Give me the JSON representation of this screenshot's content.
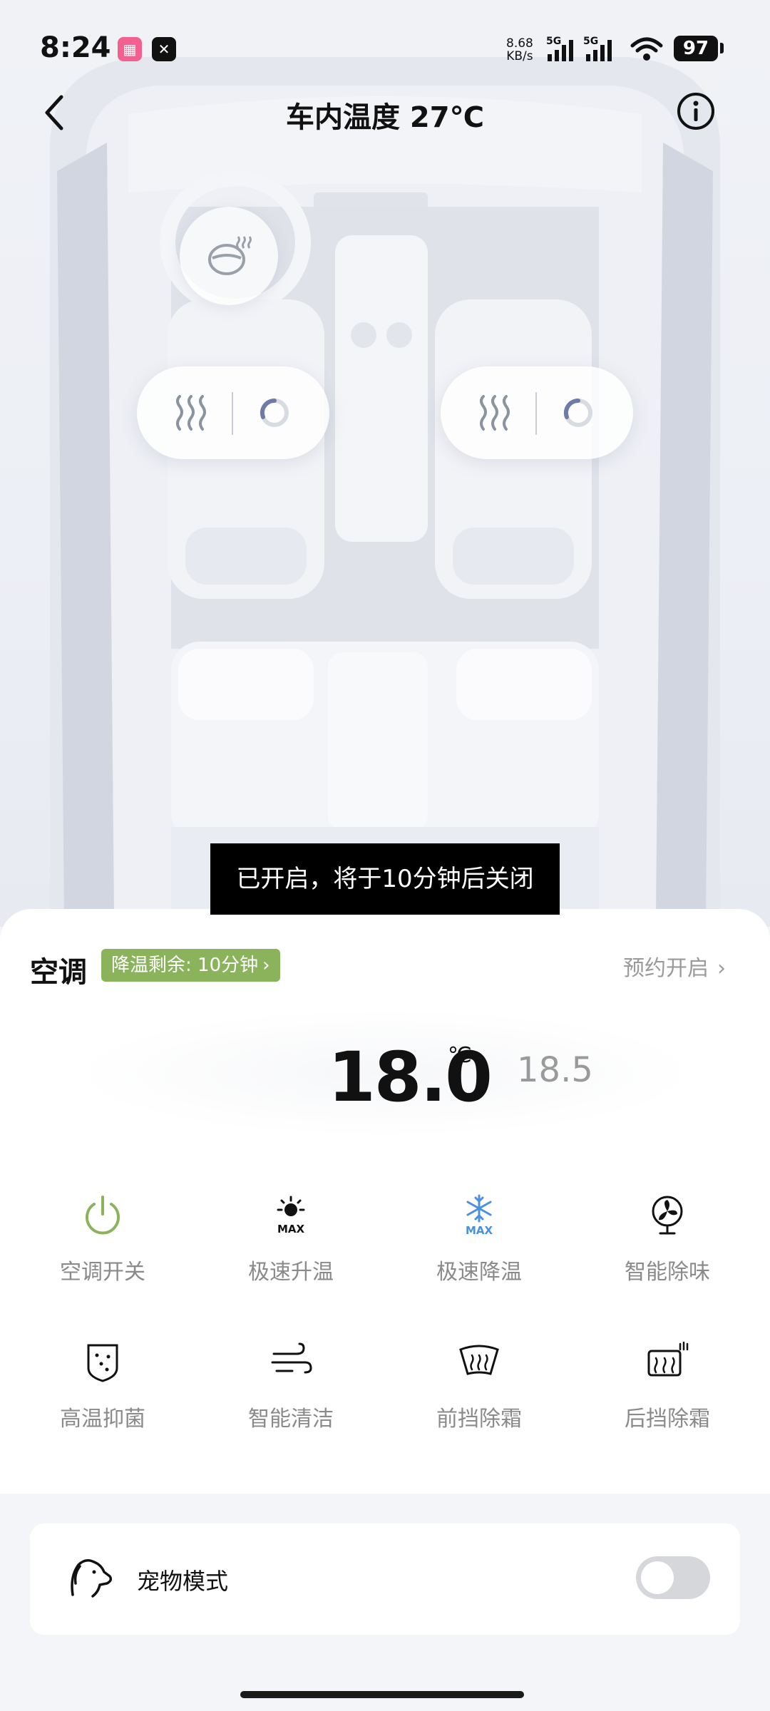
{
  "status_bar": {
    "time": "8:24",
    "net_speed_value": "8.68",
    "net_speed_unit": "KB/s",
    "signal_1_label": "5G",
    "signal_2_label": "5G",
    "battery": "97"
  },
  "header": {
    "title": "车内温度 27℃"
  },
  "toast": {
    "text": "已开启，将于10分钟后关闭"
  },
  "ac_panel": {
    "title": "空调",
    "cooling_badge": "降温剩余: 10分钟",
    "schedule_label": "预约开启",
    "temperature": "18.0",
    "temperature_unit": "℃",
    "secondary_temperature": "18.5"
  },
  "controls": [
    {
      "label": "空调开关",
      "icon": "power-icon"
    },
    {
      "label": "极速升温",
      "icon": "max-heat-icon",
      "icon_text": "MAX"
    },
    {
      "label": "极速降温",
      "icon": "max-cool-icon",
      "icon_text": "MAX"
    },
    {
      "label": "智能除味",
      "icon": "fan-icon"
    },
    {
      "label": "高温抑菌",
      "icon": "sterilize-icon"
    },
    {
      "label": "智能清洁",
      "icon": "wind-icon"
    },
    {
      "label": "前挡除霜",
      "icon": "front-defrost-icon"
    },
    {
      "label": "后挡除霜",
      "icon": "rear-defrost-icon"
    }
  ],
  "pet_mode": {
    "label": "宠物模式",
    "enabled": false
  },
  "colors": {
    "accent_green": "#8bb35c",
    "cool_blue": "#4a8fe0",
    "toast_bg": "#000000",
    "label_gray": "#8a8a8a"
  }
}
